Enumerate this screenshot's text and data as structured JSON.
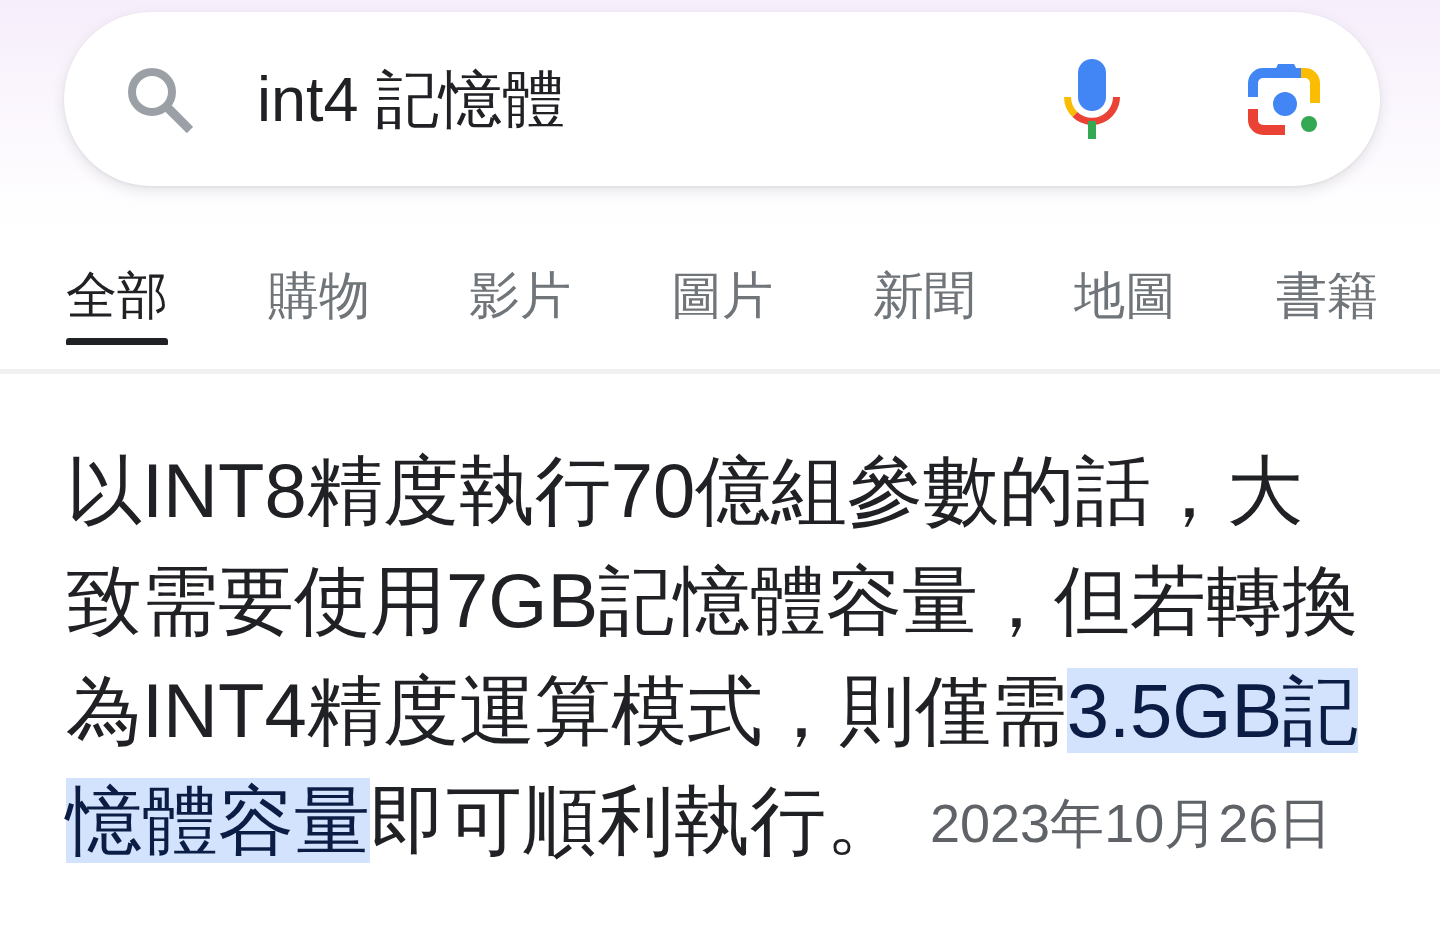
{
  "search": {
    "query": "int4 記憶體"
  },
  "tabs": [
    {
      "label": "全部",
      "selected": true
    },
    {
      "label": "購物",
      "selected": false
    },
    {
      "label": "影片",
      "selected": false
    },
    {
      "label": "圖片",
      "selected": false
    },
    {
      "label": "新聞",
      "selected": false
    },
    {
      "label": "地圖",
      "selected": false
    },
    {
      "label": "書籍",
      "selected": false
    }
  ],
  "snippet": {
    "parts": [
      {
        "text": "以INT8精度執行70億組參數的話，大致需要使用7GB記憶體容量，但若轉換為INT4精度運算模式，則僅需",
        "highlighted": false
      },
      {
        "text": "3.5GB記憶體容量",
        "highlighted": true
      },
      {
        "text": "即可順利執行。",
        "highlighted": false
      }
    ],
    "date": "2023年10月26日"
  }
}
